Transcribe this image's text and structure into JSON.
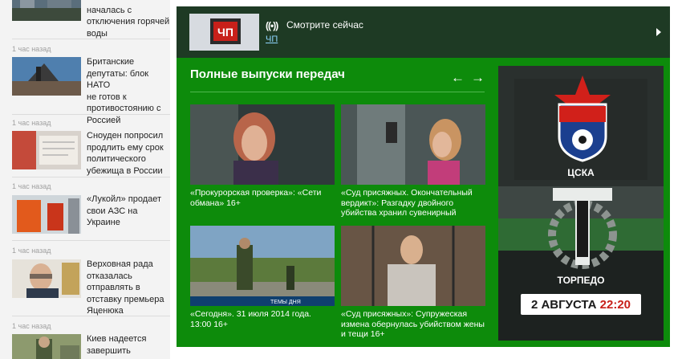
{
  "news": {
    "items": [
      {
        "time": "",
        "title_lines": [
          "началась с",
          "отключения горячей",
          "воды"
        ],
        "title_top_partial": true
      },
      {
        "time": "1 час назад",
        "title_lines": [
          "Британские",
          "депутаты: блок НАТО",
          "не готов к",
          "противостоянию с",
          "Россией"
        ]
      },
      {
        "time": "1 час назад",
        "title_lines": [
          "Сноуден попросил",
          "продлить ему срок",
          "политического",
          "убежища в России"
        ]
      },
      {
        "time": "1 час назад",
        "title_lines": [
          "«Лукойл» продает",
          "свои АЗС на Украине"
        ]
      },
      {
        "time": "1 час назад",
        "title_lines": [
          "Верховная рада",
          "отказалась",
          "отправлять в",
          "отставку премьера",
          "Яценюка"
        ]
      },
      {
        "time": "1 час назад",
        "title_lines": [
          "Киев надеется",
          "завершить"
        ]
      }
    ]
  },
  "now_bar": {
    "label": "Смотрите сейчас",
    "channel": "ЧП",
    "live_icon": "broadcast-icon"
  },
  "section": {
    "title": "Полные выпуски передач",
    "prev_label": "←",
    "next_label": "→"
  },
  "cards": [
    {
      "caption_line1": "«Прокурорская проверка»: «Сети",
      "caption_line2": "обмана» 16+",
      "caption_line3": ""
    },
    {
      "caption_line1": "«Суд присяжных. Окончательный",
      "caption_line2": "вердикт»: Разгадку двойного",
      "caption_line3": "убийства хранил сувенирный"
    },
    {
      "caption_line1": "«Сегодня». 31 июля 2014 года.",
      "caption_line2": "13:00 16+",
      "caption_line3": ""
    },
    {
      "caption_line1": "«Суд присяжных»: Супружеская",
      "caption_line2": "измена обернулась убийством жены",
      "caption_line3": "и тещи 16+"
    }
  ],
  "promo": {
    "team1": "ЦСКА",
    "team2": "ТОРПЕДО",
    "date": "2 АВГУСТА",
    "time": "22:20",
    "colors": {
      "accent_red": "#c8201a",
      "widget_green": "#0d8b0b",
      "bar_dark": "#1e3a24"
    }
  }
}
